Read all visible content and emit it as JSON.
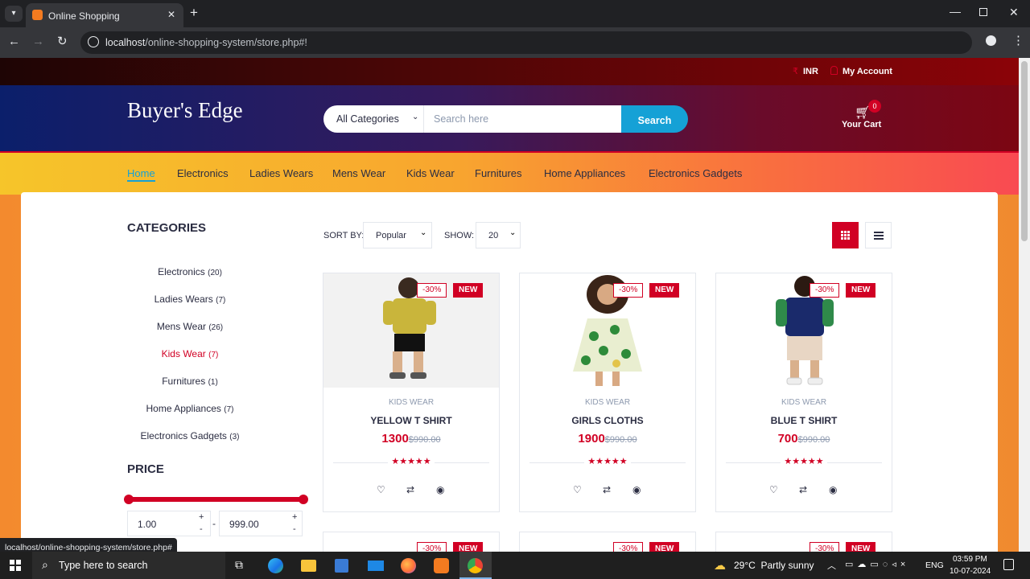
{
  "browser": {
    "tab_title": "Online Shopping",
    "url_host": "localhost",
    "url_path": "/online-shopping-system/store.php#!",
    "status_url": "localhost/online-shopping-system/store.php#"
  },
  "topbar": {
    "currency": "INR",
    "account": "My Account"
  },
  "header": {
    "logo": "Buyer's Edge",
    "category_select": "All Categories",
    "search_placeholder": "Search here",
    "search_button": "Search",
    "cart_count": "0",
    "cart_label": "Your Cart"
  },
  "nav": [
    "Home",
    "Electronics",
    "Ladies Wears",
    "Mens Wear",
    "Kids Wear",
    "Furnitures",
    "Home Appliances",
    "Electronics Gadgets"
  ],
  "sidebar": {
    "categories_title": "CATEGORIES",
    "categories": [
      {
        "name": "Electronics",
        "count": "(20)"
      },
      {
        "name": "Ladies Wears",
        "count": "(7)"
      },
      {
        "name": "Mens Wear",
        "count": "(26)"
      },
      {
        "name": "Kids Wear",
        "count": "(7)"
      },
      {
        "name": "Furnitures",
        "count": "(1)"
      },
      {
        "name": "Home Appliances",
        "count": "(7)"
      },
      {
        "name": "Electronics Gadgets",
        "count": "(3)"
      }
    ],
    "price_title": "PRICE",
    "price_min": "1.00",
    "price_max": "999.00",
    "price_sep": "-"
  },
  "toolbar": {
    "sort_label": "SORT BY:",
    "sort_value": "Popular",
    "show_label": "SHOW:",
    "show_value": "20"
  },
  "products": [
    {
      "category": "KIDS WEAR",
      "name": "YELLOW T SHIRT",
      "price": "1300",
      "old_price": "$990.00",
      "discount": "-30%",
      "badge": "NEW",
      "rating": 5
    },
    {
      "category": "KIDS WEAR",
      "name": "GIRLS CLOTHS",
      "price": "1900",
      "old_price": "$990.00",
      "discount": "-30%",
      "badge": "NEW",
      "rating": 5
    },
    {
      "category": "KIDS WEAR",
      "name": "BLUE T SHIRT",
      "price": "700",
      "old_price": "$990.00",
      "discount": "-30%",
      "badge": "NEW",
      "rating": 5
    }
  ],
  "row2_badges": {
    "discount": "-30%",
    "badge": "NEW"
  },
  "taskbar": {
    "search_placeholder": "Type here to search",
    "weather": "29°C  Partly sunny",
    "lang": "ENG",
    "time": "03:59 PM",
    "date": "10-07-2024"
  },
  "colors": {
    "accent": "#d10024",
    "search_button": "#15a1d6"
  }
}
